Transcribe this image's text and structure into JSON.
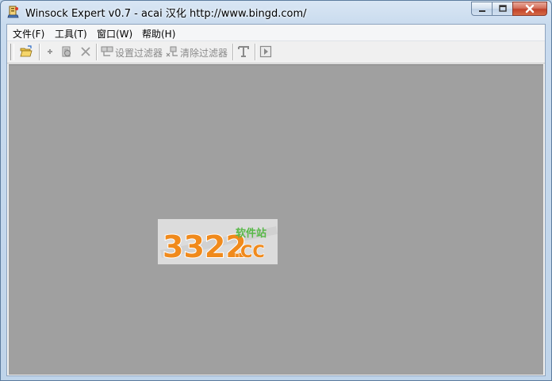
{
  "window": {
    "title": "Winsock Expert v0.7 - acai 汉化 http://www.bingd.com/",
    "icon": "app-icon"
  },
  "caption_buttons": {
    "minimize_icon": "minimize-icon",
    "maximize_icon": "maximize-icon",
    "close_icon": "close-icon"
  },
  "menubar": {
    "items": [
      {
        "label": "文件(F)"
      },
      {
        "label": "工具(T)"
      },
      {
        "label": "窗口(W)"
      },
      {
        "label": "帮助(H)"
      }
    ]
  },
  "toolbar": {
    "open_icon": "folder-open-icon",
    "add_icon": "add-icon",
    "process_icon": "process-icon",
    "delete_icon": "delete-icon",
    "set_filter_label": "设置过滤器",
    "clear_filter_label": "清除过滤器",
    "text_icon": "text-icon",
    "play_icon": "play-icon"
  },
  "watermark": {
    "digits": "3322",
    "domain": ".CC",
    "tagline": "软件站"
  },
  "colors": {
    "workspace": "#a0a0a0",
    "logo_orange": "#f08a1c",
    "logo_green": "#58b848"
  }
}
